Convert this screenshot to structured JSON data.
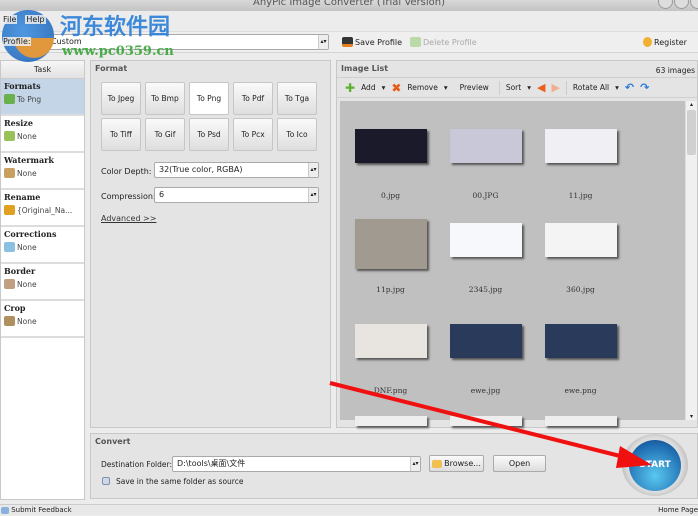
{
  "window": {
    "title": "AnyPic Image Converter (Trial Version)"
  },
  "menu": [
    "File",
    "Help"
  ],
  "watermark": {
    "site_name": "河东软件园",
    "url": "www.pc0359.cn"
  },
  "profile": {
    "label": "Profile:",
    "value": "Custom",
    "save": "Save Profile",
    "delete": "Delete Profile",
    "register": "Register"
  },
  "task": {
    "header": "Task",
    "items": [
      {
        "title": "Formats",
        "value": "To Png",
        "color": "#6ab04c"
      },
      {
        "title": "Resize",
        "value": "None",
        "color": "#9bc15a"
      },
      {
        "title": "Watermark",
        "value": "None",
        "color": "#c8a060"
      },
      {
        "title": "Rename",
        "value": "{Original_Na...",
        "color": "#e0a020"
      },
      {
        "title": "Corrections",
        "value": "None",
        "color": "#8cc0e0"
      },
      {
        "title": "Border",
        "value": "None",
        "color": "#c0a080"
      },
      {
        "title": "Crop",
        "value": "None",
        "color": "#b09060"
      }
    ]
  },
  "format": {
    "title": "Format",
    "buttons": [
      "To Jpeg",
      "To Bmp",
      "To Png",
      "To Pdf",
      "To Tga",
      "To Tiff",
      "To Gif",
      "To Psd",
      "To Pcx",
      "To Ico"
    ],
    "selected": "To Png",
    "color_depth_label": "Color Depth:",
    "color_depth": "32(True color, RGBA)",
    "compression_label": "Compression:",
    "compression": "6",
    "advanced": "Advanced >>"
  },
  "image_list": {
    "title": "Image List",
    "count": "63 images",
    "toolbar": {
      "add": "Add",
      "remove": "Remove",
      "preview": "Preview",
      "sort": "Sort",
      "rotate_all": "Rotate All"
    },
    "images": [
      {
        "name": "0.jpg",
        "bg": "#1a1a2a"
      },
      {
        "name": "00.JPG",
        "bg": "#c8c8d8"
      },
      {
        "name": "11.jpg",
        "bg": "#f0f0f4"
      },
      {
        "name": "11p.jpg",
        "bg": "#a09a90"
      },
      {
        "name": "2345.jpg",
        "bg": "#f6f8fc"
      },
      {
        "name": "360.jpg",
        "bg": "#f4f4f4"
      },
      {
        "name": "DNF.png",
        "bg": "#e8e4e0"
      },
      {
        "name": "ewe.jpg",
        "bg": "#2a3a5a"
      },
      {
        "name": "ewe.png",
        "bg": "#2a3a5a"
      }
    ]
  },
  "convert": {
    "title": "Convert",
    "dest_label": "Destination Folder:",
    "dest_value": "D:\\tools\\桌面\\文件",
    "browse": "Browse...",
    "open": "Open",
    "same_folder": "Save in the same folder as source",
    "start": "START"
  },
  "status": {
    "feedback": "Submit Feedback",
    "home": "Home Page"
  }
}
